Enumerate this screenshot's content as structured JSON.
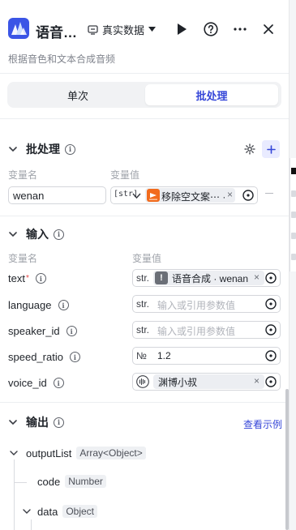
{
  "header": {
    "app_name": "语音…",
    "data_source": "真实数据",
    "subtitle": "根据音色和文本合成音频"
  },
  "tabs": [
    {
      "label": "单次",
      "active": false
    },
    {
      "label": "批处理",
      "active": true
    }
  ],
  "batch": {
    "title": "批处理",
    "col_name": "变量名",
    "col_value": "变量值",
    "row": {
      "name": "wenan",
      "type": "[str]",
      "ref_label": "移除空文案⋯ ·"
    }
  },
  "inputs": {
    "title": "输入",
    "col_name": "变量名",
    "col_value": "变量值",
    "rows": [
      {
        "name": "text",
        "required": true,
        "type": "str.",
        "value": "语音合成 · wenan",
        "kind": "ref"
      },
      {
        "name": "language",
        "type": "str.",
        "placeholder": "输入或引用参数值",
        "kind": "empty"
      },
      {
        "name": "speaker_id",
        "type": "str.",
        "placeholder": "输入或引用参数值",
        "kind": "empty"
      },
      {
        "name": "speed_ratio",
        "type": "№",
        "value": "1.2",
        "kind": "value"
      },
      {
        "name": "voice_id",
        "value": "渊博小叔",
        "kind": "voice"
      }
    ]
  },
  "outputs": {
    "title": "输出",
    "example_link": "查看示例",
    "tree": [
      {
        "name": "outputList",
        "type": "Array<Object>"
      },
      {
        "name": "code",
        "type": "Number"
      },
      {
        "name": "data",
        "type": "Object"
      }
    ]
  },
  "colors": {
    "accent": "#3546d8",
    "app_icon": "#3b55e6",
    "ref_icon": "#f26b1d",
    "required": "#e54545"
  }
}
